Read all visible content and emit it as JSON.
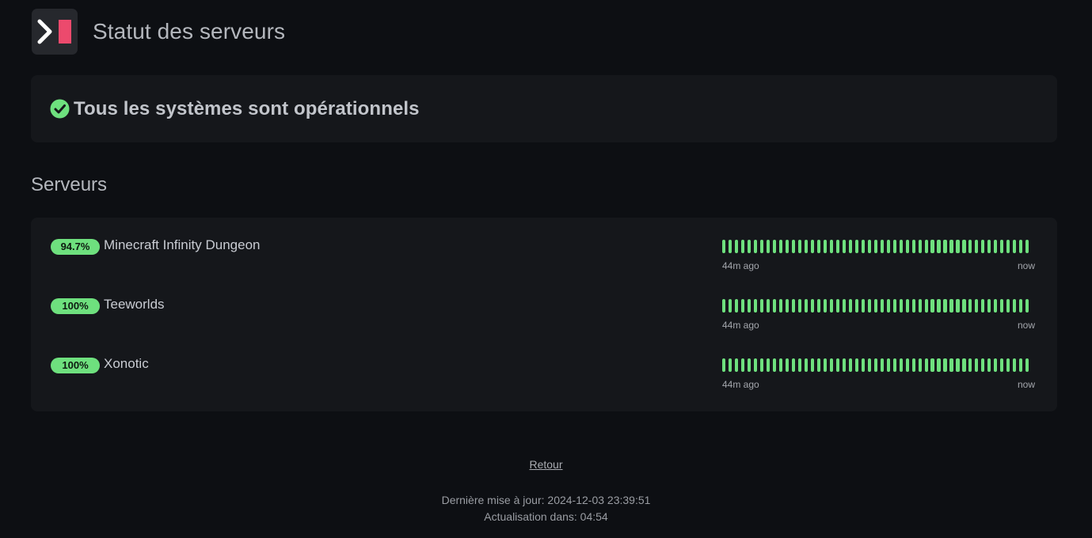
{
  "header": {
    "title": "Statut des serveurs",
    "logo_icon": "terminal-prompt-logo",
    "logo_colors": {
      "chevron": "#ffffff",
      "block": "#ec4a6d",
      "background": "#26282d"
    }
  },
  "overall_status": {
    "icon": "check-circle-icon",
    "text": "Tous les systèmes sont opérationnels",
    "color": "#6ee07e"
  },
  "servers_section": {
    "title": "Serveurs",
    "bar_color": "#6ee07e",
    "servers": [
      {
        "uptime": "94.7%",
        "name": "Minecraft Infinity Dungeon",
        "bars_up": 49,
        "start_label": "44m ago",
        "end_label": "now"
      },
      {
        "uptime": "100%",
        "name": "Teeworlds",
        "bars_up": 49,
        "start_label": "44m ago",
        "end_label": "now"
      },
      {
        "uptime": "100%",
        "name": "Xonotic",
        "bars_up": 49,
        "start_label": "44m ago",
        "end_label": "now"
      }
    ]
  },
  "footer": {
    "back_link": "Retour",
    "last_update": "Dernière mise à jour: 2024-12-03 23:39:51",
    "refresh": "Actualisation dans: 04:54"
  }
}
